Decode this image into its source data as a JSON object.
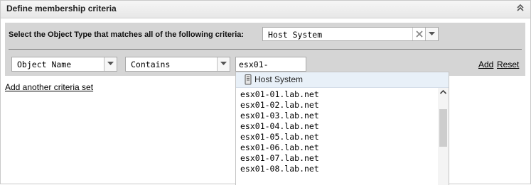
{
  "panel": {
    "title": "Define membership criteria",
    "collapse_icon": "double-chevron-up-icon"
  },
  "criteria": {
    "object_type_label": "Select the Object Type that matches all of the following criteria:",
    "object_type_value": "Host System",
    "clear_icon": "x-icon",
    "property_value": "Object Name",
    "operator_value": "Contains",
    "search_value": "esx01-",
    "add_label": "Add",
    "reset_label": "Reset"
  },
  "add_another_label": "Add another criteria set",
  "suggestions": {
    "header_icon": "host-icon",
    "header_label": "Host System",
    "items": [
      "esx01-01.lab.net",
      "esx01-02.lab.net",
      "esx01-03.lab.net",
      "esx01-04.lab.net",
      "esx01-05.lab.net",
      "esx01-06.lab.net",
      "esx01-07.lab.net",
      "esx01-08.lab.net"
    ]
  }
}
